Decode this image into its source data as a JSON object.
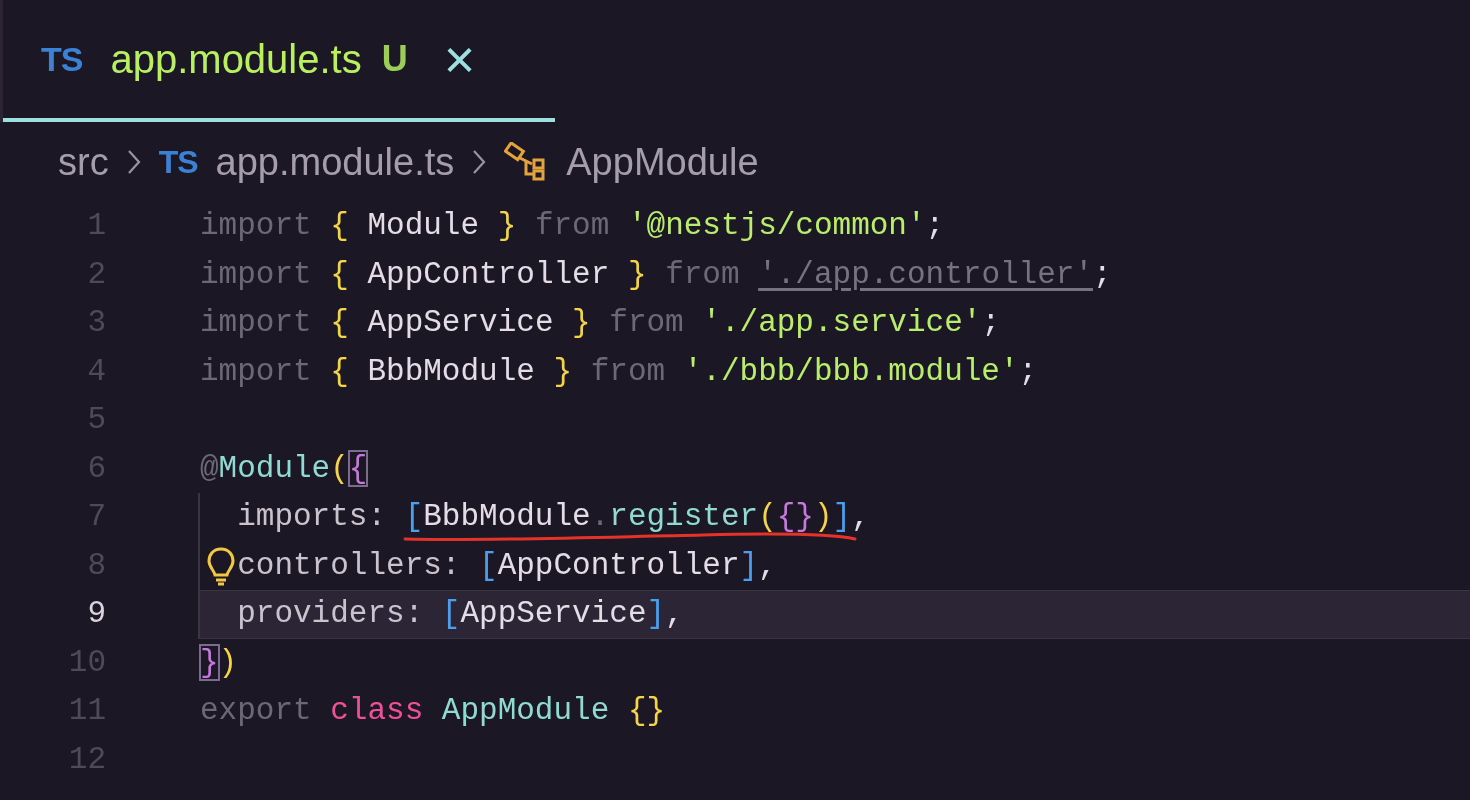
{
  "tab": {
    "icon": "TS",
    "label": "app.module.ts",
    "status": "U",
    "close": "×",
    "selected": true
  },
  "breadcrumbs": [
    {
      "kind": "folder",
      "label": "src"
    },
    {
      "kind": "file",
      "icon": "TS",
      "label": "app.module.ts"
    },
    {
      "kind": "symbol",
      "label": "AppModule"
    }
  ],
  "lines": [
    {
      "number": "1",
      "current": false,
      "tokens": [
        {
          "text": "import ",
          "kind": "keyword"
        },
        {
          "text": "{ ",
          "kind": "brace"
        },
        {
          "text": "Module ",
          "kind": "plain"
        },
        {
          "text": "} ",
          "kind": "brace"
        },
        {
          "text": "from ",
          "kind": "keyword"
        },
        {
          "text": "'@nestjs/common'",
          "kind": "string"
        },
        {
          "text": ";",
          "kind": "plain"
        }
      ]
    },
    {
      "number": "2",
      "current": false,
      "tokens": [
        {
          "text": "import ",
          "kind": "keyword"
        },
        {
          "text": "{ ",
          "kind": "brace"
        },
        {
          "text": "AppController ",
          "kind": "plain"
        },
        {
          "text": "} ",
          "kind": "brace"
        },
        {
          "text": "from ",
          "kind": "keyword"
        },
        {
          "text": "'./app.controller'",
          "kind": "unused-string"
        },
        {
          "text": ";",
          "kind": "plain"
        }
      ]
    },
    {
      "number": "3",
      "current": false,
      "tokens": [
        {
          "text": "import ",
          "kind": "keyword"
        },
        {
          "text": "{ ",
          "kind": "brace"
        },
        {
          "text": "AppService ",
          "kind": "plain"
        },
        {
          "text": "} ",
          "kind": "brace"
        },
        {
          "text": "from ",
          "kind": "keyword"
        },
        {
          "text": "'./app.service'",
          "kind": "string"
        },
        {
          "text": ";",
          "kind": "plain"
        }
      ]
    },
    {
      "number": "4",
      "current": false,
      "tokens": [
        {
          "text": "import ",
          "kind": "keyword"
        },
        {
          "text": "{ ",
          "kind": "brace"
        },
        {
          "text": "BbbModule ",
          "kind": "plain"
        },
        {
          "text": "} ",
          "kind": "brace"
        },
        {
          "text": "from ",
          "kind": "keyword"
        },
        {
          "text": "'./bbb/bbb.module'",
          "kind": "string"
        },
        {
          "text": ";",
          "kind": "plain"
        }
      ]
    },
    {
      "number": "5",
      "current": false
    },
    {
      "number": "6",
      "current": false,
      "tokens": [
        {
          "text": "@",
          "kind": "keyword"
        },
        {
          "text": "Module",
          "kind": "function"
        },
        {
          "text": "(",
          "kind": "brace"
        },
        {
          "text": "{",
          "kind": "matched-brace"
        }
      ]
    },
    {
      "number": "7",
      "current": false,
      "guide": true,
      "annotated": true,
      "tokens": [
        {
          "text": "  imports: ",
          "kind": "property"
        },
        {
          "text": "[",
          "kind": "bracket"
        },
        {
          "text": "BbbModule",
          "kind": "plain"
        },
        {
          "text": ".",
          "kind": "keyword"
        },
        {
          "text": "register",
          "kind": "function"
        },
        {
          "text": "(",
          "kind": "brace"
        },
        {
          "text": "{}",
          "kind": "object-brace"
        },
        {
          "text": ")",
          "kind": "brace"
        },
        {
          "text": "]",
          "kind": "bracket"
        },
        {
          "text": ",",
          "kind": "plain"
        }
      ]
    },
    {
      "number": "8",
      "current": false,
      "guide": true,
      "lightbulb": true,
      "tokens": [
        {
          "text": "  controllers: ",
          "kind": "property"
        },
        {
          "text": "[",
          "kind": "bracket"
        },
        {
          "text": "AppController",
          "kind": "plain"
        },
        {
          "text": "]",
          "kind": "bracket"
        },
        {
          "text": ",",
          "kind": "plain"
        }
      ]
    },
    {
      "number": "9",
      "current": true,
      "guide": true,
      "tokens": [
        {
          "text": "  providers: ",
          "kind": "property"
        },
        {
          "text": "[",
          "kind": "bracket"
        },
        {
          "text": "AppService",
          "kind": "plain"
        },
        {
          "text": "]",
          "kind": "bracket"
        },
        {
          "text": ",",
          "kind": "plain"
        }
      ]
    },
    {
      "number": "10",
      "current": false,
      "tokens": [
        {
          "text": "}",
          "kind": "matched-brace"
        },
        {
          "text": ")",
          "kind": "brace"
        }
      ]
    },
    {
      "number": "11",
      "current": false,
      "tokens": [
        {
          "text": "export ",
          "kind": "keyword"
        },
        {
          "text": "class ",
          "kind": "storage"
        },
        {
          "text": "AppModule ",
          "kind": "function"
        },
        {
          "text": "{}",
          "kind": "brace"
        }
      ]
    },
    {
      "number": "12",
      "current": false
    }
  ]
}
